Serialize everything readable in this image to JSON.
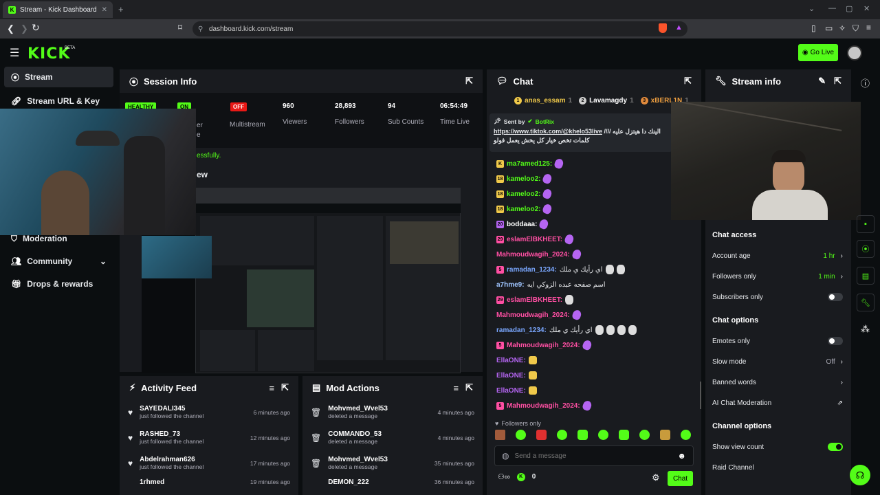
{
  "browser": {
    "tab_title": "Stream - Kick Dashboard",
    "url": "dashboard.kick.com/stream"
  },
  "header": {
    "logo": "KICK",
    "beta": "BETA",
    "go_live": "Go Live"
  },
  "sidebar": {
    "items": [
      {
        "label": "Stream",
        "icon": "broadcast-icon"
      },
      {
        "label": "Stream URL & Key",
        "icon": "link-icon"
      },
      {
        "label": "Moderation",
        "icon": "shield-icon"
      },
      {
        "label": "Community",
        "icon": "people-icon"
      },
      {
        "label": "Drops & rewards",
        "icon": "gift-icon"
      }
    ]
  },
  "session": {
    "title": "Session Info",
    "healthy": "HEALTHY",
    "on": "ON",
    "on_label_fragment1": "er",
    "on_label_fragment2": "e",
    "off": "OFF",
    "multistream": "Multistream",
    "stats": [
      {
        "value": "960",
        "label": "Viewers"
      },
      {
        "value": "28,893",
        "label": "Followers"
      },
      {
        "value": "94",
        "label": "Sub Counts"
      },
      {
        "value": "06:54:49",
        "label": "Time Live"
      }
    ],
    "notice": "essfully.",
    "preview_fragment": "ew"
  },
  "activity": {
    "title": "Activity Feed",
    "rows": [
      {
        "name": "SAYEDALI345",
        "sub": "just followed the channel",
        "time": "6 minutes ago"
      },
      {
        "name": "RASHED_73",
        "sub": "just followed the channel",
        "time": "12 minutes ago"
      },
      {
        "name": "Abdelrahman626",
        "sub": "just followed the channel",
        "time": "17 minutes ago"
      },
      {
        "name": "1rhmed",
        "sub": "",
        "time": "19 minutes ago"
      }
    ]
  },
  "mod": {
    "title": "Mod Actions",
    "rows": [
      {
        "name": "Mohvmed_Wvel53",
        "sub": "deleted a message",
        "time": "4 minutes ago"
      },
      {
        "name": "COMMANDO_53",
        "sub": "deleted a message",
        "time": "4 minutes ago"
      },
      {
        "name": "Mohvmed_Wvel53",
        "sub": "deleted a message",
        "time": "35 minutes ago"
      },
      {
        "name": "DEMON_222",
        "sub": "",
        "time": "36 minutes ago"
      }
    ]
  },
  "chat": {
    "title": "Chat",
    "top_gifters": [
      {
        "rank": "1",
        "name": "anas_essam",
        "count": "1"
      },
      {
        "rank": "2",
        "name": "Lavamagdy",
        "count": "1"
      },
      {
        "rank": "3",
        "name": "xBERL1N",
        "count": "1"
      }
    ],
    "pinned": {
      "sent_by": "Sent by",
      "bot": "BotRix",
      "link": "https://www.tiktok.com/@khelo53live",
      "text1": "//// الينك دا هيتزل عليه",
      "text2": "كلمات تخص خيار كل يخش يعمل فولو"
    },
    "messages": [
      {
        "badge": "K",
        "user": "ma7amed125:",
        "color": "#53fc18",
        "emotes": 1,
        "etype": "p"
      },
      {
        "badge": "18",
        "user": "kameloo2:",
        "color": "#53fc18",
        "emotes": 1,
        "etype": "p"
      },
      {
        "badge": "18",
        "user": "kameloo2:",
        "color": "#53fc18",
        "emotes": 1,
        "etype": "p"
      },
      {
        "badge": "18",
        "user": "kameloo2:",
        "color": "#53fc18",
        "emotes": 1,
        "etype": "p"
      },
      {
        "badge": "20",
        "user": "boddaaa:",
        "color": "#ffffff",
        "emotes": 1,
        "etype": "p"
      },
      {
        "badge": "29",
        "user": "eslamElBKHEET:",
        "color": "#ff4fa3",
        "emotes": 1,
        "etype": "p"
      },
      {
        "badge": "",
        "user": "Mahmoudwagih_2024:",
        "color": "#ff4fa3",
        "emotes": 1,
        "etype": "p"
      },
      {
        "badge": "5",
        "user": "ramadan_1234:",
        "color": "#7aa7ff",
        "text": "اي رأيك ي ملك",
        "emotes": 2,
        "etype": "w"
      },
      {
        "badge": "",
        "user": "a7hme9:",
        "color": "#9fc5ff",
        "text": "اسم صفحه عبده الزوكي ايه",
        "emotes": 0,
        "etype": ""
      },
      {
        "badge": "29",
        "user": "eslamElBKHEET:",
        "color": "#ff4fa3",
        "emotes": 1,
        "etype": "w"
      },
      {
        "badge": "",
        "user": "Mahmoudwagih_2024:",
        "color": "#ff4fa3",
        "emotes": 1,
        "etype": "p"
      },
      {
        "badge": "",
        "user": "ramadan_1234:",
        "color": "#7aa7ff",
        "text": "اي رأيك ي ملك",
        "emotes": 4,
        "etype": "w"
      },
      {
        "badge": "5",
        "user": "Mahmoudwagih_2024:",
        "color": "#ff4fa3",
        "emotes": 1,
        "etype": "p"
      },
      {
        "badge": "",
        "user": "EllaONE:",
        "color": "#b565f2",
        "emotes": 1,
        "etype": "y"
      },
      {
        "badge": "",
        "user": "EllaONE:",
        "color": "#b565f2",
        "emotes": 1,
        "etype": "y"
      },
      {
        "badge": "",
        "user": "EllaONE:",
        "color": "#b565f2",
        "emotes": 1,
        "etype": "y"
      },
      {
        "badge": "5",
        "user": "Mahmoudwagih_2024:",
        "color": "#ff4fa3",
        "emotes": 1,
        "etype": "p"
      }
    ],
    "followers_only": "Followers only",
    "placeholder": "Send a message",
    "count": "0",
    "send": "Chat"
  },
  "streaminfo": {
    "title": "Stream info",
    "chat_access": "Chat access",
    "rows_access": [
      {
        "label": "Account age",
        "value": "1 hr",
        "type": "arrow"
      },
      {
        "label": "Followers only",
        "value": "1 min",
        "type": "arrow"
      },
      {
        "label": "Subscribers only",
        "value": "",
        "type": "toggle-off"
      }
    ],
    "chat_options": "Chat options",
    "rows_options": [
      {
        "label": "Emotes only",
        "value": "",
        "type": "toggle-off"
      },
      {
        "label": "Slow mode",
        "value": "Off",
        "type": "arrow-grey"
      },
      {
        "label": "Banned words",
        "value": "",
        "type": "arrow"
      },
      {
        "label": "AI Chat Moderation",
        "value": "",
        "type": "external"
      }
    ],
    "channel_options": "Channel options",
    "rows_channel": [
      {
        "label": "Show view count",
        "value": "",
        "type": "toggle-on"
      },
      {
        "label": "Raid Channel",
        "value": "",
        "type": "none"
      }
    ]
  },
  "colors": {
    "accent": "#53fc18",
    "panel": "#191b1f",
    "bg": "#0b0e10"
  }
}
